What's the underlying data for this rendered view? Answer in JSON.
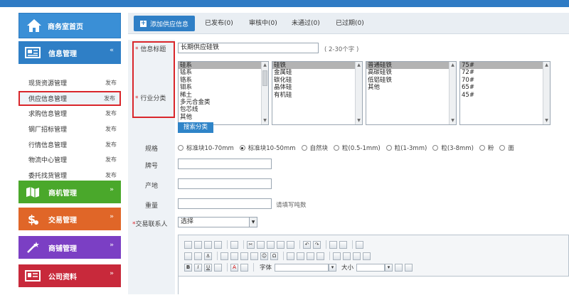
{
  "sidebar": {
    "home": "商务室首页",
    "info": {
      "label": "信息管理",
      "chev": "«"
    },
    "items": [
      {
        "label": "现货资源管理",
        "tag": "发布"
      },
      {
        "label": "供应信息管理",
        "tag": "发布"
      },
      {
        "label": "求购信息管理",
        "tag": "发布"
      },
      {
        "label": "钢厂招标管理",
        "tag": "发布"
      },
      {
        "label": "行情信息管理",
        "tag": "发布"
      },
      {
        "label": "物流中心管理",
        "tag": "发布"
      },
      {
        "label": "委托找货管理",
        "tag": "发布"
      }
    ],
    "sections": [
      {
        "label": "商机管理",
        "color": "#4aa82b",
        "chev": "»"
      },
      {
        "label": "交易管理",
        "color": "#e06628",
        "chev": "»"
      },
      {
        "label": "商铺管理",
        "color": "#7b3fc4",
        "chev": "»"
      },
      {
        "label": "公司资料",
        "color": "#c8293b",
        "chev": "»"
      }
    ]
  },
  "tabs": {
    "add": "添加供应信息",
    "list": [
      "已发布(0)",
      "审核中(0)",
      "未通过(0)",
      "已过期(0)"
    ]
  },
  "form": {
    "title_label": "信息标题",
    "title_value": "长期供应硅铁",
    "title_hint": "( 2-30个字 )",
    "category_label": "行业分类",
    "required_mark": "*",
    "col1": [
      "硅系",
      "锰系",
      "铬系",
      "钼系",
      "稀土",
      "多元合金类",
      "包芯线",
      "其他"
    ],
    "col2": [
      "硅铁",
      "金属硅",
      "碳化硅",
      "晶体硅",
      "有机硅"
    ],
    "col3": [
      "普通硅铁",
      "高碳硅铁",
      "低铝硅铁",
      "其他"
    ],
    "col4": [
      "75#",
      "72#",
      "70#",
      "65#",
      "45#"
    ],
    "search_btn": "搜索分类",
    "spec_label": "规格",
    "spec_options": [
      "标准块10-70mm",
      "标准块10-50mm",
      "自然块",
      "粒(0.5-1mm)",
      "粒(1-3mm)",
      "粒(3-8mm)",
      "粉",
      "面"
    ],
    "brand_label": "牌号",
    "origin_label": "产地",
    "weight_label": "重量",
    "weight_hint": "请填写吨数",
    "contact_label": "交易联系人",
    "contact_value": "选择",
    "font_label": "字体",
    "size_label": "大小"
  }
}
